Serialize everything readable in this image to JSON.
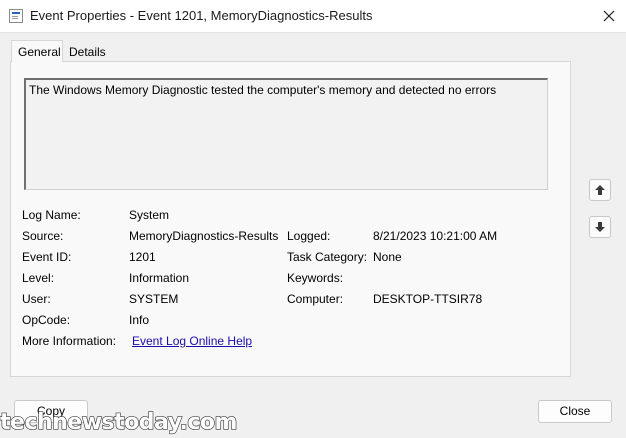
{
  "window": {
    "title": "Event Properties - Event 1201, MemoryDiagnostics-Results",
    "icon": "event-viewer-icon",
    "close_icon": "close-icon"
  },
  "tabs": [
    {
      "label": "General",
      "active": true
    },
    {
      "label": "Details",
      "active": false
    }
  ],
  "description": "The Windows Memory Diagnostic tested the computer's memory and detected no errors",
  "fields": {
    "log_name": {
      "label": "Log Name:",
      "value": "System"
    },
    "source": {
      "label": "Source:",
      "value": "MemoryDiagnostics-Results"
    },
    "logged": {
      "label": "Logged:",
      "value": "8/21/2023 10:21:00 AM"
    },
    "event_id": {
      "label": "Event ID:",
      "value": "1201"
    },
    "task_category": {
      "label": "Task Category:",
      "value": "None"
    },
    "level": {
      "label": "Level:",
      "value": "Information"
    },
    "keywords": {
      "label": "Keywords:",
      "value": ""
    },
    "user": {
      "label": "User:",
      "value": "SYSTEM"
    },
    "computer": {
      "label": "Computer:",
      "value": "DESKTOP-TTSIR78"
    },
    "opcode": {
      "label": "OpCode:",
      "value": "Info"
    },
    "more_info": {
      "label": "More Information:",
      "link": "Event Log Online Help"
    }
  },
  "nav": {
    "up_icon": "arrow-up-icon",
    "down_icon": "arrow-down-icon"
  },
  "buttons": {
    "copy": "Copy",
    "close": "Close"
  },
  "watermark": "technewstoday.com"
}
